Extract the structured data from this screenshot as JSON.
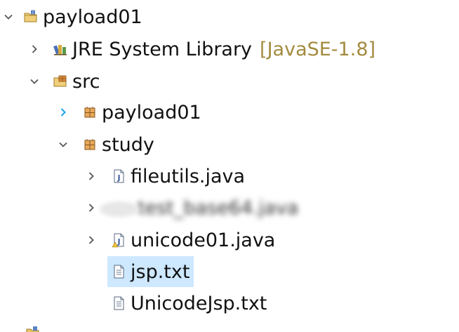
{
  "tree": {
    "nodes": [
      {
        "label": "payload01",
        "decoration": "",
        "icon": "java-project-icon",
        "toggle": "expanded",
        "selected": false,
        "blurred": false
      },
      {
        "label": "JRE System Library",
        "decoration": "[JavaSE-1.8]",
        "icon": "library-icon",
        "toggle": "collapsed",
        "selected": false,
        "blurred": false
      },
      {
        "label": "src",
        "decoration": "",
        "icon": "source-folder-icon",
        "toggle": "expanded",
        "selected": false,
        "blurred": false
      },
      {
        "label": "payload01",
        "decoration": "",
        "icon": "package-icon",
        "toggle": "collapsed-hover",
        "selected": false,
        "blurred": false
      },
      {
        "label": "study",
        "decoration": "",
        "icon": "package-icon",
        "toggle": "expanded",
        "selected": false,
        "blurred": false
      },
      {
        "label": "fileutils.java",
        "decoration": "",
        "icon": "java-file-icon",
        "toggle": "collapsed",
        "selected": false,
        "blurred": false
      },
      {
        "label": "test_base64.java",
        "decoration": "",
        "icon": "java-file-icon",
        "toggle": "collapsed",
        "selected": false,
        "blurred": true
      },
      {
        "label": "unicode01.java",
        "decoration": "",
        "icon": "java-file-warning-icon",
        "toggle": "collapsed",
        "selected": false,
        "blurred": false
      },
      {
        "label": "jsp.txt",
        "decoration": "",
        "icon": "text-file-icon",
        "toggle": "none",
        "selected": true,
        "blurred": false
      },
      {
        "label": "UnicodeJsp.txt",
        "decoration": "",
        "icon": "text-file-icon",
        "toggle": "none",
        "selected": false,
        "blurred": false
      }
    ]
  },
  "colors": {
    "selection": "#cde8ff",
    "decoration": "#a38b3f",
    "toggle": "#555555",
    "toggle_hover": "#1ea1e6",
    "text": "#111111"
  }
}
